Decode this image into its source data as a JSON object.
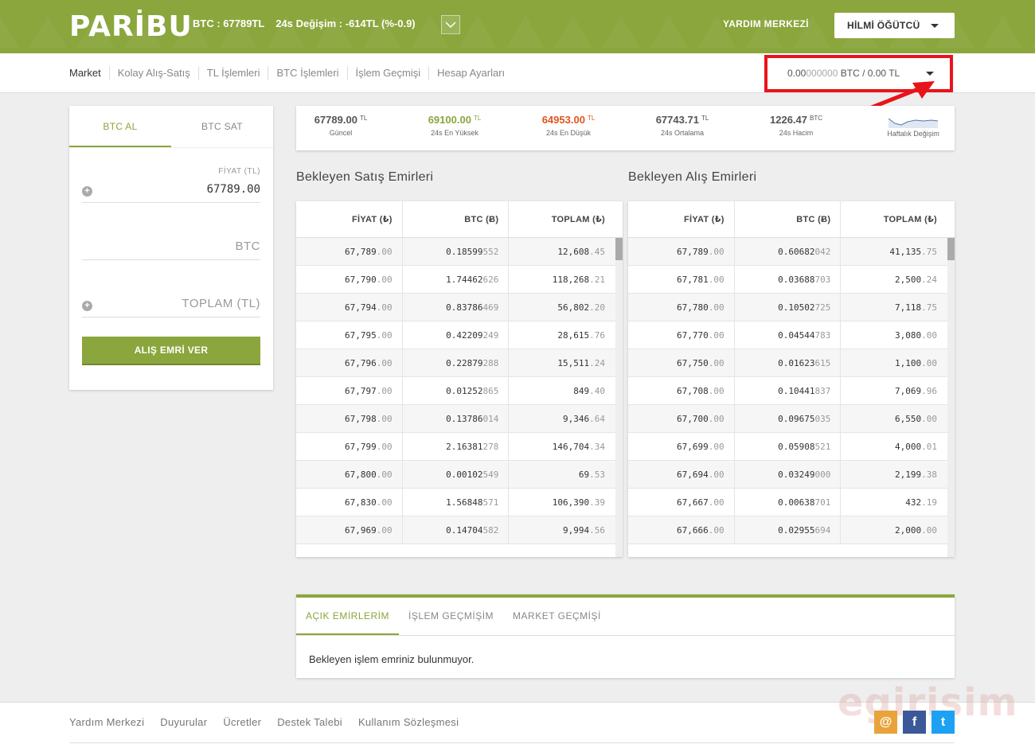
{
  "header": {
    "logo": "PARİBU",
    "btc_price": "BTC : 67789TL",
    "change": "24s Değişim : -614TL (%-0.9)",
    "help": "YARDIM MERKEZİ",
    "user": "HİLMİ ÖĞÜTCÜ"
  },
  "nav": [
    "Market",
    "Kolay Alış-Satış",
    "TL İşlemleri",
    "BTC İşlemleri",
    "İşlem Geçmişi",
    "Hesap Ayarları"
  ],
  "balance": {
    "btc_strong": "0.00",
    "btc_dim": "000000",
    "btc_unit": " BTC / ",
    "tl_strong": "0.00",
    "tl_unit": " TL"
  },
  "form": {
    "tab_buy": "BTC AL",
    "tab_sell": "BTC SAT",
    "price_label": "FİYAT (TL)",
    "price_value": "67789.00",
    "btc_placeholder": "BTC",
    "total_placeholder": "TOPLAM (TL)",
    "submit": "ALIŞ EMRİ VER"
  },
  "stats": [
    {
      "value": "67789.00",
      "unit": "TL",
      "label": "Güncel",
      "tone": "normal"
    },
    {
      "value": "69100.00",
      "unit": "TL",
      "label": "24s En Yüksek",
      "tone": "green"
    },
    {
      "value": "64953.00",
      "unit": "TL",
      "label": "24s En Düşük",
      "tone": "red"
    },
    {
      "value": "67743.71",
      "unit": "TL",
      "label": "24s Ortalama",
      "tone": "normal"
    },
    {
      "value": "1226.47",
      "unit": "BTC",
      "label": "24s Hacim",
      "tone": "normal"
    }
  ],
  "weekly_label": "Haftalık Değişim",
  "sell_book": {
    "title": "Bekleyen Satış Emirleri",
    "headers": [
      "FİYAT (₺)",
      "BTC (Ƀ)",
      "TOPLAM (₺)"
    ],
    "rows": [
      [
        "67,789",
        ".00",
        "0.18599",
        "552",
        "12,608",
        ".45"
      ],
      [
        "67,790",
        ".00",
        "1.74462",
        "626",
        "118,268",
        ".21"
      ],
      [
        "67,794",
        ".00",
        "0.83786",
        "469",
        "56,802",
        ".20"
      ],
      [
        "67,795",
        ".00",
        "0.42209",
        "249",
        "28,615",
        ".76"
      ],
      [
        "67,796",
        ".00",
        "0.22879",
        "288",
        "15,511",
        ".24"
      ],
      [
        "67,797",
        ".00",
        "0.01252",
        "865",
        "849",
        ".40"
      ],
      [
        "67,798",
        ".00",
        "0.13786",
        "014",
        "9,346",
        ".64"
      ],
      [
        "67,799",
        ".00",
        "2.16381",
        "278",
        "146,704",
        ".34"
      ],
      [
        "67,800",
        ".00",
        "0.00102",
        "549",
        "69",
        ".53"
      ],
      [
        "67,830",
        ".00",
        "1.56848",
        "571",
        "106,390",
        ".39"
      ],
      [
        "67,969",
        ".00",
        "0.14704",
        "582",
        "9,994",
        ".56"
      ]
    ]
  },
  "buy_book": {
    "title": "Bekleyen Alış Emirleri",
    "headers": [
      "FİYAT (₺)",
      "BTC (Ƀ)",
      "TOPLAM (₺)"
    ],
    "rows": [
      [
        "67,789",
        ".00",
        "0.60682",
        "042",
        "41,135",
        ".75"
      ],
      [
        "67,781",
        ".00",
        "0.03688",
        "703",
        "2,500",
        ".24"
      ],
      [
        "67,780",
        ".00",
        "0.10502",
        "725",
        "7,118",
        ".75"
      ],
      [
        "67,770",
        ".00",
        "0.04544",
        "783",
        "3,080",
        ".00"
      ],
      [
        "67,750",
        ".00",
        "0.01623",
        "615",
        "1,100",
        ".00"
      ],
      [
        "67,708",
        ".00",
        "0.10441",
        "837",
        "7,069",
        ".96"
      ],
      [
        "67,700",
        ".00",
        "0.09675",
        "035",
        "6,550",
        ".00"
      ],
      [
        "67,699",
        ".00",
        "0.05908",
        "521",
        "4,000",
        ".01"
      ],
      [
        "67,694",
        ".00",
        "0.03249",
        "000",
        "2,199",
        ".38"
      ],
      [
        "67,667",
        ".00",
        "0.00638",
        "701",
        "432",
        ".19"
      ],
      [
        "67,666",
        ".00",
        "0.02955",
        "694",
        "2,000",
        ".00"
      ]
    ]
  },
  "orders": {
    "tabs": [
      "AÇIK EMİRLERİM",
      "İŞLEM GEÇMİŞİM",
      "MARKET GEÇMİŞİ"
    ],
    "empty": "Bekleyen işlem emriniz bulunmuyor."
  },
  "footer": [
    "Yardım Merkezi",
    "Duyurular",
    "Ücretler",
    "Destek Talebi",
    "Kullanım Sözleşmesi"
  ],
  "watermark": "egirisim",
  "social": [
    {
      "icon": "email-icon",
      "glyph": "@",
      "color": "#e8a33a"
    },
    {
      "icon": "facebook-icon",
      "glyph": "f",
      "color": "#3b5998"
    },
    {
      "icon": "twitter-icon",
      "glyph": "t",
      "color": "#1da1f2"
    }
  ]
}
